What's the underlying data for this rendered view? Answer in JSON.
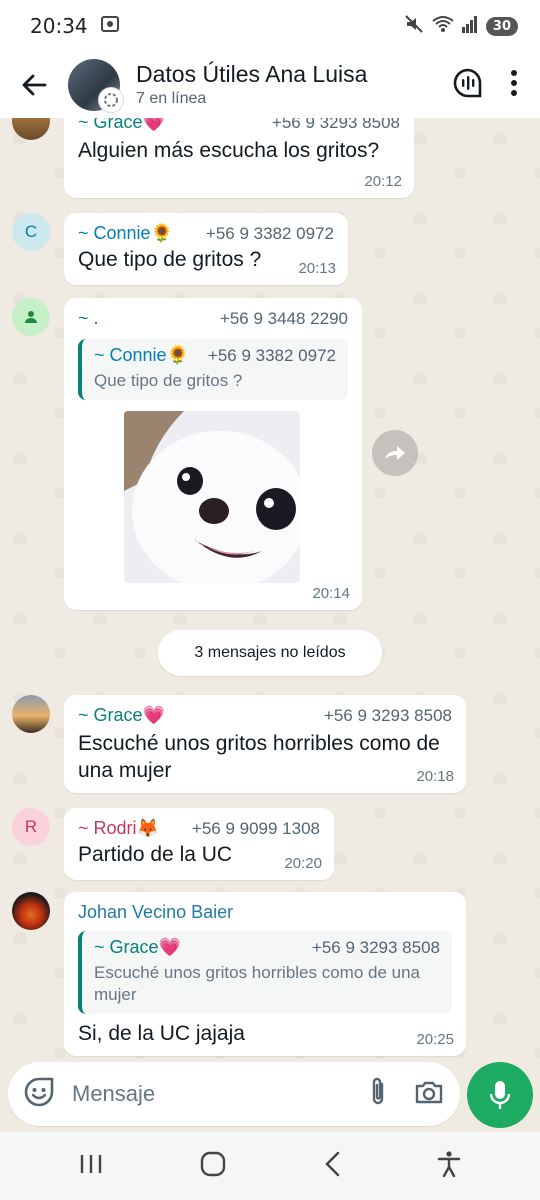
{
  "status_bar": {
    "time": "20:34",
    "battery": "30"
  },
  "header": {
    "title": "Datos Útiles Ana Luisa",
    "subtitle": "7 en línea"
  },
  "messages": [
    {
      "sender": "~ Grace💗",
      "phone": "+56 9 3293 8508",
      "text": "Alguien más escucha los gritos?",
      "time": "20:12"
    },
    {
      "avatar_letter": "C",
      "sender": "~ Connie🌻",
      "phone": "+56 9 3382 0972",
      "text": "Que tipo de gritos ?",
      "time": "20:13"
    },
    {
      "sender": "~ .",
      "phone": "+56 9 3448 2290",
      "quote": {
        "sender": "~ Connie🌻",
        "phone": "+56 9 3382 0972",
        "text": "Que tipo de gritos ?"
      },
      "time": "20:14"
    },
    {
      "sender": "~ Grace💗",
      "phone": "+56 9 3293 8508",
      "text": "Escuché unos gritos horribles como de una mujer",
      "time": "20:18"
    },
    {
      "avatar_letter": "R",
      "sender": "~ Rodri🦊",
      "phone": "+56 9 9099 1308",
      "text": "Partido de la UC",
      "time": "20:20"
    },
    {
      "sender": "Johan Vecino Baier",
      "quote": {
        "sender": "~ Grace💗",
        "phone": "+56 9 3293 8508",
        "text": "Escuché unos gritos horribles como de una mujer"
      },
      "text": "Si, de la UC jajaja",
      "time": "20:25"
    }
  ],
  "unread_divider": "3 mensajes no leídos",
  "input": {
    "placeholder": "Mensaje"
  },
  "colors": {
    "connie": "#027eb5",
    "teal": "#06827a",
    "rodri": "#c4375f",
    "johan": "#1f7aa6",
    "grace": "#06827a",
    "mic": "#1daa61"
  }
}
